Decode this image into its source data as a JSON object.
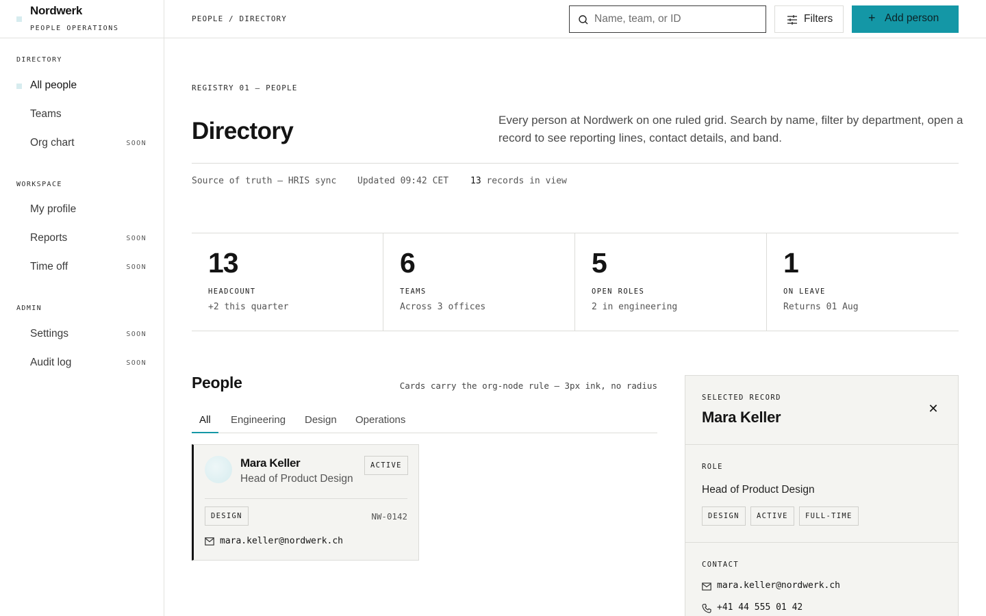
{
  "brand": {
    "name": "Nordwerk",
    "subtitle": "PEOPLE OPERATIONS"
  },
  "sidebar": {
    "sections": [
      {
        "title": "DIRECTORY",
        "items": [
          {
            "label": "All people",
            "tag": "",
            "active": true
          },
          {
            "label": "Teams",
            "tag": ""
          },
          {
            "label": "Org chart",
            "tag": "SOON"
          }
        ]
      },
      {
        "title": "WORKSPACE",
        "items": [
          {
            "label": "My profile",
            "tag": ""
          },
          {
            "label": "Reports",
            "tag": "SOON"
          },
          {
            "label": "Time off",
            "tag": "SOON"
          }
        ]
      },
      {
        "title": "ADMIN",
        "items": [
          {
            "label": "Settings",
            "tag": "SOON"
          },
          {
            "label": "Audit log",
            "tag": "SOON"
          }
        ]
      }
    ]
  },
  "topbar": {
    "breadcrumb": "PEOPLE / DIRECTORY",
    "search_placeholder": "Name, team, or ID",
    "search_value": "",
    "filters_label": "Filters",
    "add_label": "Add person",
    "accent": "#1497a6"
  },
  "hero": {
    "eyebrow": "REGISTRY 01 — PEOPLE",
    "title": "Directory",
    "intro": "Every person at Nordwerk on one ruled grid. Search by name, filter by department, open a record to see reporting lines, contact details, and band.",
    "meta_source": "Source of truth — HRIS sync",
    "meta_updated": "Updated 09:42 CET",
    "meta_count": "13",
    "meta_count_suffix": " records in view"
  },
  "stats": [
    {
      "value": "13",
      "label": "HEADCOUNT",
      "sub": "+2 this quarter"
    },
    {
      "value": "6",
      "label": "TEAMS",
      "sub": "Across 3 offices"
    },
    {
      "value": "5",
      "label": "OPEN ROLES",
      "sub": "2 in engineering"
    },
    {
      "value": "1",
      "label": "ON LEAVE",
      "sub": "Returns 01 Aug"
    }
  ],
  "people": {
    "title": "People",
    "note": "Cards carry the org-node rule — 3px ink, no radius",
    "tabs": [
      "All",
      "Engineering",
      "Design",
      "Operations"
    ],
    "active_tab": 0,
    "cards": [
      {
        "name": "Mara Keller",
        "role": "Head of Product Design",
        "status": "ACTIVE",
        "department": "DESIGN",
        "id": "NW-0142",
        "email": "mara.keller@nordwerk.ch"
      }
    ]
  },
  "detail": {
    "caption": "SELECTED RECORD",
    "name": "Mara Keller",
    "close_icon": "close-icon",
    "role_caption": "ROLE",
    "role": "Head of Product Design",
    "tags": [
      "DESIGN",
      "ACTIVE",
      "FULL-TIME"
    ],
    "contact_caption": "CONTACT",
    "email": "mara.keller@nordwerk.ch",
    "phone": "+41 44 555 01 42"
  }
}
